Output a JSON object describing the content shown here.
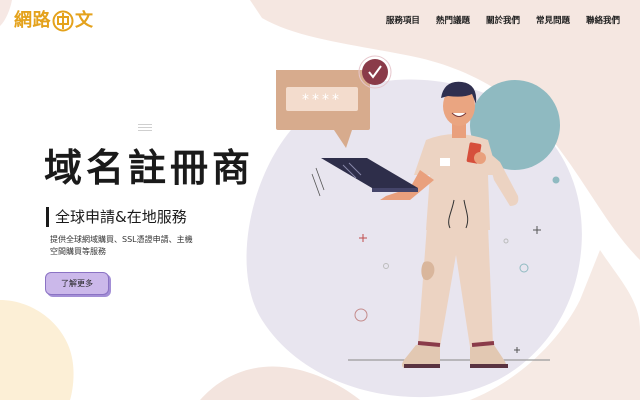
{
  "header": {
    "logo_left": "網路",
    "logo_right": "文",
    "nav": [
      "服務項目",
      "熱門議題",
      "關於我們",
      "常見問題",
      "聯絡我們"
    ]
  },
  "hero": {
    "title": "域名註冊商",
    "subtitle": "全球申請&在地服務",
    "description": "提供全球網域購買、SSL憑證申請、主機空間購買等服務",
    "cta": "了解更多"
  },
  "illustration": {
    "password_mask": "****"
  },
  "colors": {
    "logo": "#e4a21c",
    "cta_bg": "#cbb8ea",
    "blob_pink": "#f3e4de",
    "blob_lavender": "#e6e3ee",
    "circle_teal": "#8fbac1",
    "check_badge": "#8a3b49"
  }
}
